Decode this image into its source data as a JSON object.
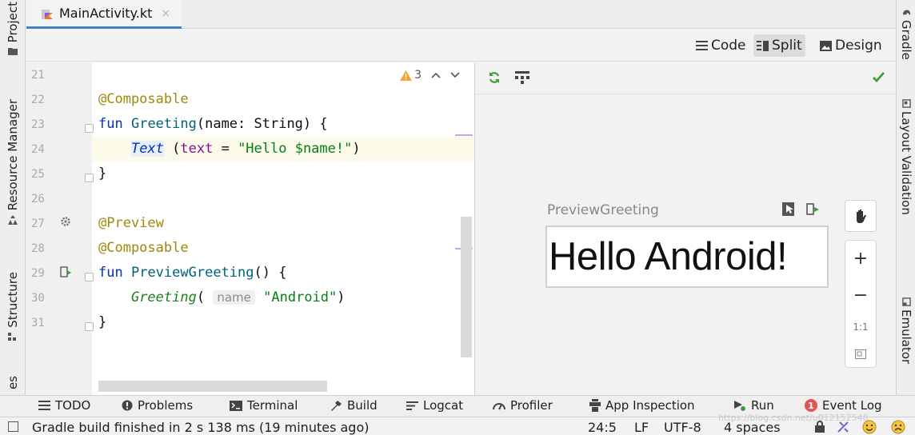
{
  "left_stripe": {
    "tabs": [
      {
        "label": "Project",
        "icon": "folder-icon"
      },
      {
        "label": "Resource Manager",
        "icon": "resource-manager-icon"
      },
      {
        "label": "Structure",
        "icon": "structure-icon"
      },
      {
        "label": "es",
        "icon": ""
      }
    ]
  },
  "right_stripe": {
    "tabs": [
      {
        "label": "Gradle",
        "icon": "gradle-elephant-icon"
      },
      {
        "label": "Layout Validation",
        "icon": "layout-validation-icon"
      },
      {
        "label": "Emulator",
        "icon": "emulator-icon"
      }
    ]
  },
  "editor_tab": {
    "filename": "MainActivity.kt",
    "close": "×",
    "icon": "kotlin-file-icon"
  },
  "view_modes": {
    "code": "Code",
    "split": "Split",
    "design": "Design",
    "active": "Split"
  },
  "inspection": {
    "count": "3",
    "icon": "warning-icon"
  },
  "code": {
    "lines": [
      {
        "n": "21"
      },
      {
        "n": "22"
      },
      {
        "n": "23"
      },
      {
        "n": "24"
      },
      {
        "n": "25"
      },
      {
        "n": "26"
      },
      {
        "n": "27"
      },
      {
        "n": "28"
      },
      {
        "n": "29"
      },
      {
        "n": "30"
      },
      {
        "n": "31"
      }
    ],
    "t": {
      "ann_composable": "@Composable",
      "kw_fun": "fun",
      "greeting_sig_name": "Greeting",
      "greeting_sig_rest": "(name: String) {",
      "text_call": "Text",
      "text_open": " (",
      "text_param": "text",
      "text_eq": " = ",
      "text_str": "\"Hello $name!\"",
      "text_close": ")",
      "close_brace": "}",
      "ann_preview": "@Preview",
      "preview_sig_name": "PreviewGreeting",
      "preview_sig_rest": "() {",
      "greeting_call": "Greeting",
      "greeting_open": "(",
      "hint_name": "name",
      "android_str": "\"Android\"",
      "greeting_close": ")"
    }
  },
  "preview": {
    "title": "PreviewGreeting",
    "text": "Hello Android!",
    "status_color": "#3d9e3d",
    "zoom": {
      "plus": "+",
      "minus": "−",
      "ratio": "1:1"
    }
  },
  "tool_windows": [
    {
      "label": "TODO",
      "icon": "todo-list-icon"
    },
    {
      "label": "Problems",
      "icon": "problems-icon"
    },
    {
      "label": "Terminal",
      "icon": "terminal-icon"
    },
    {
      "label": "Build",
      "icon": "build-hammer-icon"
    },
    {
      "label": "Logcat",
      "icon": "logcat-icon"
    },
    {
      "label": "Profiler",
      "icon": "profiler-gauge-icon"
    },
    {
      "label": "App Inspection",
      "icon": "app-inspection-icon"
    },
    {
      "label": "Run",
      "icon": "run-icon"
    },
    {
      "label": "Event Log",
      "icon": "event-log-icon",
      "badge": "1"
    }
  ],
  "status": {
    "message": "Gradle build finished in 2 s 138 ms (19 minutes ago)",
    "position": "24:5",
    "line_sep": "LF",
    "encoding": "UTF-8",
    "indent": "4 spaces",
    "watermark": "https://blog.csdn.net/u012152548"
  },
  "colors": {
    "accent": "#4083c9",
    "warning": "#f0a732",
    "error": "#e05555"
  }
}
